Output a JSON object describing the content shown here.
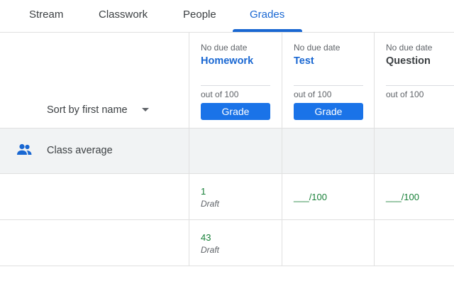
{
  "tabs": [
    {
      "label": "Stream"
    },
    {
      "label": "Classwork"
    },
    {
      "label": "People"
    },
    {
      "label": "Grades"
    }
  ],
  "active_tab": "Grades",
  "sort": {
    "label": "Sort by first name"
  },
  "columns": [
    {
      "due": "No due date",
      "title": "Homework",
      "out_of": "out of 100",
      "button": "Grade"
    },
    {
      "due": "No due date",
      "title": "Test",
      "out_of": "out of 100",
      "button": "Grade"
    },
    {
      "due": "No due date",
      "title": "Question",
      "out_of": "out of 100"
    }
  ],
  "class_average": {
    "label": "Class average",
    "icon": "people-icon"
  },
  "rows": [
    {
      "homework_score": "1",
      "homework_status": "Draft",
      "test_blank": "___/100",
      "question_blank": "___/100"
    },
    {
      "homework_score": "43",
      "homework_status": "Draft"
    }
  ],
  "colors": {
    "accent": "#1967d2",
    "button": "#1a73e8",
    "score_green": "#188038",
    "avg_bg": "#f1f3f4"
  }
}
